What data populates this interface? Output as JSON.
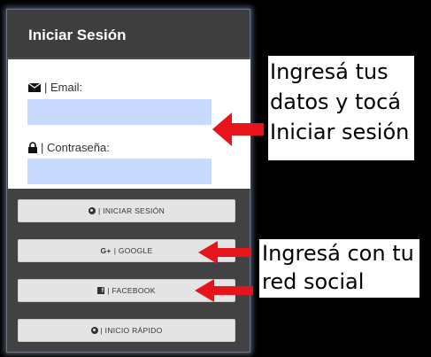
{
  "panel": {
    "title": "Iniciar Sesión"
  },
  "form": {
    "email_label": "| Email:",
    "email_value": "",
    "password_label": "| Contraseña:",
    "password_value": ""
  },
  "buttons": {
    "login": "| INICIAR SESIÓN",
    "google_icon": "G+",
    "google": "| GOOGLE",
    "facebook": "| FACEBOOK",
    "quick": "| INICIO RÁPIDO"
  },
  "annotations": {
    "callout1_line1": "Ingresá tus",
    "callout1_line2": "datos y tocá",
    "callout1_line3": "Iniciar sesión",
    "callout2_line1": "Ingresá con tu",
    "callout2_line2": "red social"
  },
  "icons": {
    "email": "envelope-icon",
    "password": "lock-icon",
    "login": "user-icon",
    "facebook": "facebook-icon",
    "quick": "user-icon"
  },
  "colors": {
    "panel_bg": "#424242",
    "input_bg": "#c9daff",
    "button_bg": "#e4e4e4",
    "arrow": "#e8141c"
  }
}
